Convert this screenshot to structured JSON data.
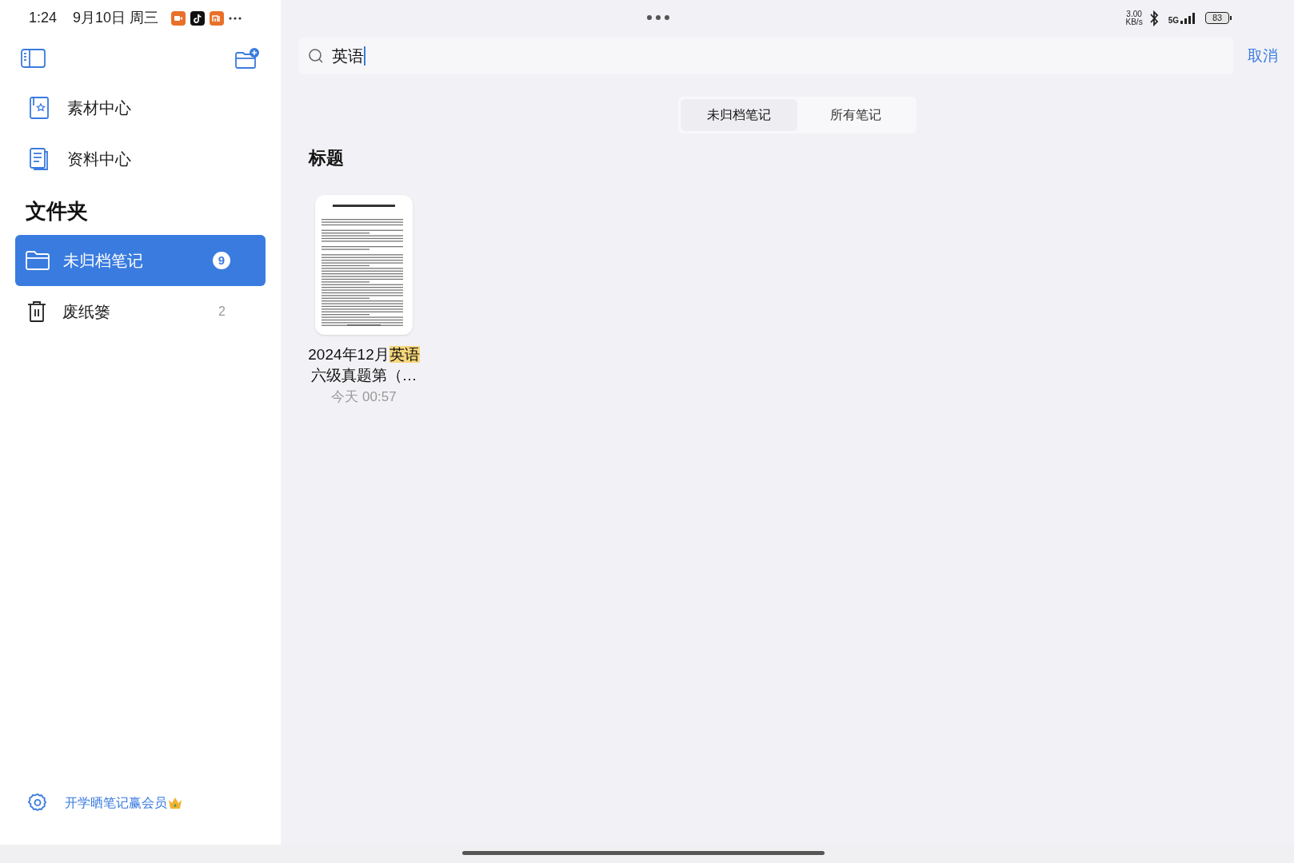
{
  "status_bar": {
    "time": "1:24",
    "date": "9月10日 周三",
    "speed_value": "3.00",
    "speed_unit": "KB/s",
    "network_type": "5G",
    "battery": "83"
  },
  "sidebar": {
    "nav_items": [
      {
        "label": "素材中心",
        "kind": "materials"
      },
      {
        "label": "资料中心",
        "kind": "documents"
      }
    ],
    "folders_heading": "文件夹",
    "folders": [
      {
        "label": "未归档笔记",
        "count": "9",
        "selected": true,
        "kind": "folder"
      },
      {
        "label": "废纸篓",
        "count": "2",
        "selected": false,
        "kind": "trash"
      }
    ],
    "footer_link": "开学晒笔记赢会员"
  },
  "search": {
    "value": "英语",
    "cancel": "取消"
  },
  "tabs": [
    {
      "label": "未归档笔记",
      "selected": true
    },
    {
      "label": "所有笔记",
      "selected": false
    }
  ],
  "section_title": "标题",
  "notes": [
    {
      "title_parts": [
        {
          "text": "2024年12月",
          "highlighted": false
        },
        {
          "text": "英语",
          "highlighted": true
        },
        {
          "text": "六级真题第（…",
          "highlighted": false
        }
      ],
      "date": "今天 00:57"
    }
  ]
}
